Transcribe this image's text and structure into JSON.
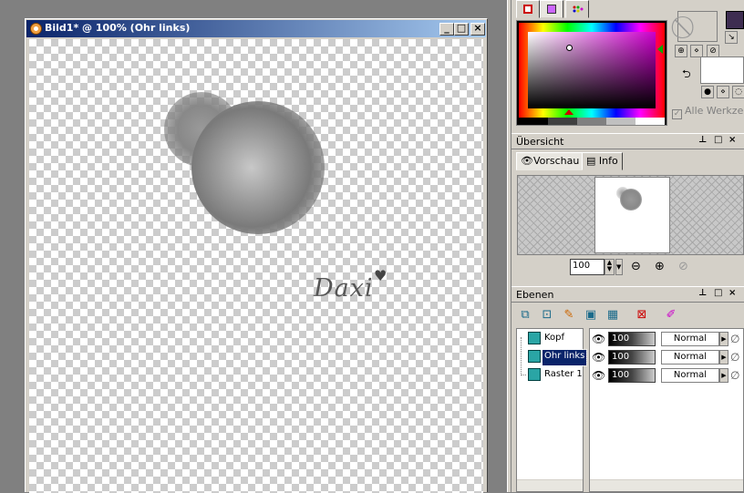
{
  "document": {
    "title": "Bild1* @ 100% (Ohr links)",
    "watermark_text": "Daxi"
  },
  "materials": {
    "tabs": [
      "gradient-palette",
      "rainbow-palette",
      "swatches"
    ],
    "all_tools_label": "Alle Werkzeuge",
    "fg_color": "#3e2d51",
    "bg_color": "#ffffff"
  },
  "overview": {
    "header": "Übersicht",
    "tabs": [
      {
        "label": "Vorschau"
      },
      {
        "label": "Info"
      }
    ],
    "zoom_value": "100"
  },
  "layers": {
    "header": "Ebenen",
    "items": [
      {
        "name": "Kopf",
        "opacity": "100",
        "blend": "Normal",
        "selected": false
      },
      {
        "name": "Ohr links",
        "opacity": "100",
        "blend": "Normal",
        "selected": true
      },
      {
        "name": "Raster 1",
        "opacity": "100",
        "blend": "Normal",
        "selected": false
      }
    ]
  }
}
